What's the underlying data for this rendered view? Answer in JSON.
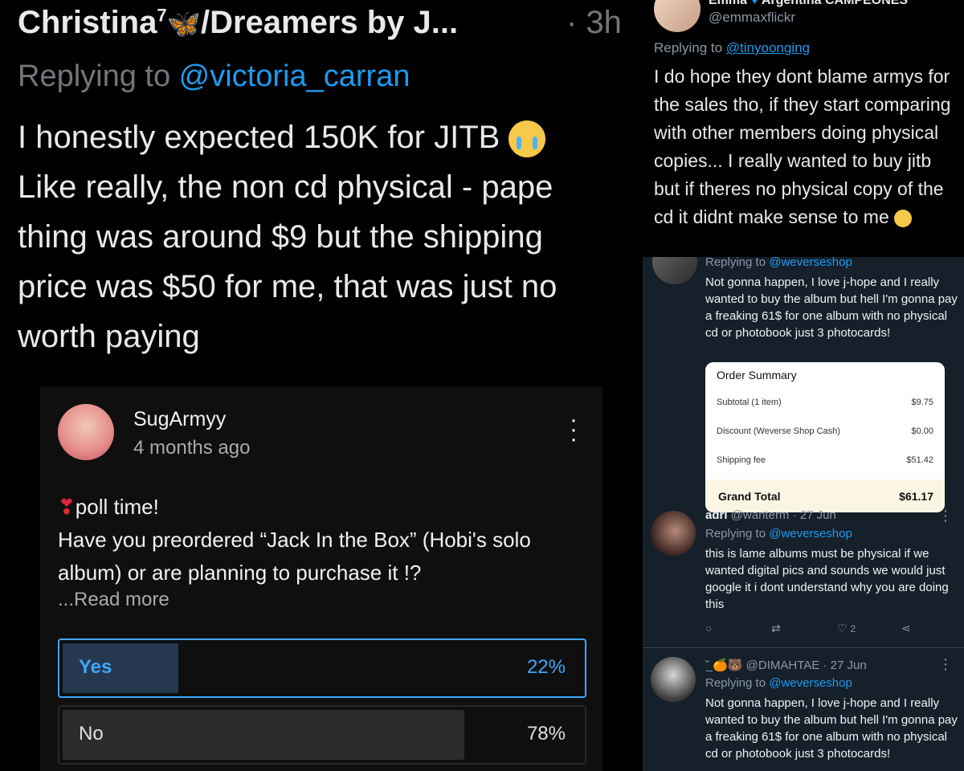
{
  "panel1": {
    "name": "Christina",
    "superscript": "7",
    "name_rest": "/Dreamers by J...",
    "time": "· 3h",
    "replying_prefix": "Replying to ",
    "replying_handle": "@victoria_carran",
    "lines": [
      "I honestly expected 150K for JITB",
      "Like really, the non cd physical - pape",
      "thing was around $9 but the shipping",
      "price was $50 for me, that was just no",
      "worth paying"
    ]
  },
  "panel2": {
    "name": "Emma",
    "name_suffix": "Argentina CAMPEONES",
    "handle": "@emmaxflickr",
    "replying_prefix": "Replying to ",
    "replying_handle": "@tinyoonging",
    "body": "I do hope they dont blame armys for the sales tho, if they start comparing with other members doing physical copies... I really wanted to buy jitb but if theres no physical copy of the cd it didnt make sense to me"
  },
  "panel3": {
    "tweet1": {
      "replying_prefix": "Replying to ",
      "replying_handle": "@weverseshop",
      "body": "Not gonna happen, I love j-hope and I really wanted to buy the album but hell I'm gonna pay a freaking 61$ for one album with no physical cd or photobook just 3 photocards!",
      "order": {
        "title": "Order Summary",
        "rows": [
          {
            "label": "Subtotal (1 item)",
            "value": "$9.75"
          },
          {
            "label": "Discount (Weverse Shop Cash)",
            "value": "$0.00"
          },
          {
            "label": "Shipping fee",
            "value": "$51.42"
          }
        ],
        "total_label": "Grand Total",
        "total_value": "$61.17"
      }
    },
    "tweet2": {
      "name": "adri",
      "handle_time": "@wanterm · 27 Jun",
      "replying_prefix": "Replying to ",
      "replying_handle": "@weverseshop",
      "body": "this is lame albums must be physical if we wanted digital pics and sounds we would just google it i dont understand why you are doing this",
      "likes": "2"
    },
    "tweet3": {
      "name": "˘̲ 🍊🐻 @DIMAHTAE · 27 Jun",
      "replying_prefix": "Replying to ",
      "replying_handle": "@weverseshop",
      "body": "Not gonna happen, I love j-hope and I really wanted to buy the album but hell I'm gonna pay a freaking 61$ for one album with no physical cd or photobook just 3 photocards!"
    }
  },
  "panel4": {
    "name": "SugArmyy",
    "ago": "4 months ago",
    "line1": "poll time!",
    "line2": "Have you preordered “Jack In the Box” (Hobi's solo album) or are planning to purchase it !?",
    "read_more": "...Read more",
    "options": [
      {
        "label": "Yes",
        "pct": "22%",
        "fraction": 0.22
      },
      {
        "label": "No",
        "pct": "78%",
        "fraction": 0.78
      }
    ]
  },
  "colors": {
    "twitter_blue": "#1d9bf0",
    "dim_bg": "#15202b",
    "poll_selected": "#3ea6ff"
  }
}
